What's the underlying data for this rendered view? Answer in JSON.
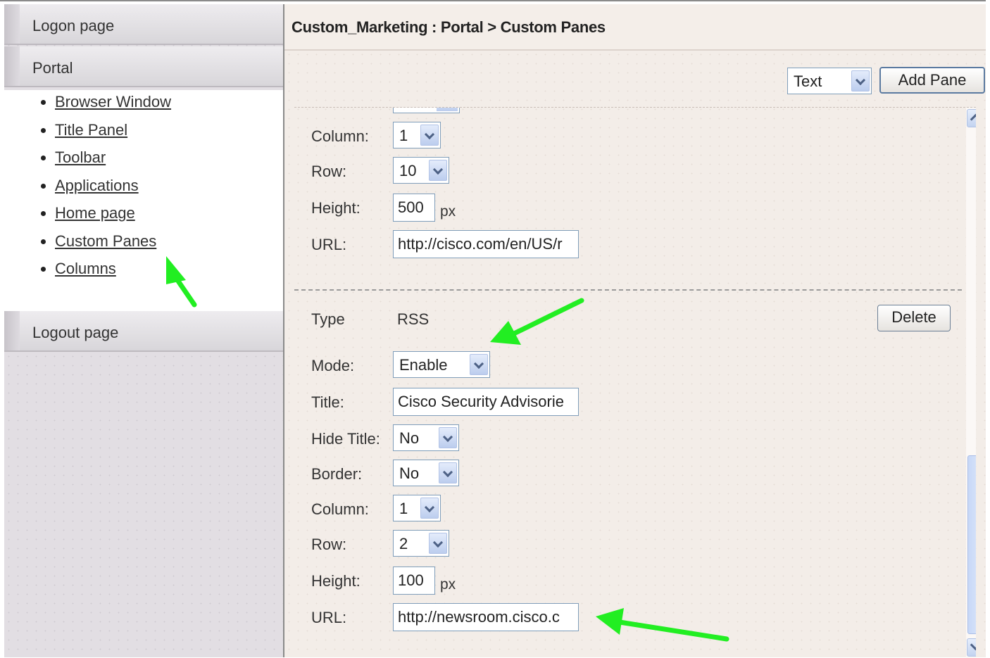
{
  "sidebar": {
    "sections": [
      {
        "label": "Logon page"
      },
      {
        "label": "Portal"
      },
      {
        "label": "Logout page"
      }
    ],
    "portal_items": [
      {
        "label": "Browser Window"
      },
      {
        "label": "Title Panel"
      },
      {
        "label": "Toolbar"
      },
      {
        "label": "Applications"
      },
      {
        "label": "Home page"
      },
      {
        "label": "Custom Panes"
      },
      {
        "label": "Columns"
      }
    ]
  },
  "header": {
    "title": "Custom_Marketing : Portal > Custom Panes"
  },
  "toolbar": {
    "pane_type": "Text",
    "add_label": "Add Pane"
  },
  "pane1": {
    "column_label": "Column:",
    "column_value": "1",
    "row_label": "Row:",
    "row_value": "10",
    "height_label": "Height:",
    "height_value": "500",
    "height_unit": "px",
    "url_label": "URL:",
    "url_value": "http://cisco.com/en/US/r"
  },
  "pane2": {
    "type_label": "Type",
    "type_value": "RSS",
    "delete_label": "Delete",
    "mode_label": "Mode:",
    "mode_value": "Enable",
    "title_label": "Title:",
    "title_value": "Cisco Security Advisorie",
    "hide_title_label": "Hide Title:",
    "hide_title_value": "No",
    "border_label": "Border:",
    "border_value": "No",
    "column_label": "Column:",
    "column_value": "1",
    "row_label": "Row:",
    "row_value": "2",
    "height_label": "Height:",
    "height_value": "100",
    "height_unit": "px",
    "url_label": "URL:",
    "url_value": "http://newsroom.cisco.c"
  },
  "annotation_color": "#22ee22"
}
